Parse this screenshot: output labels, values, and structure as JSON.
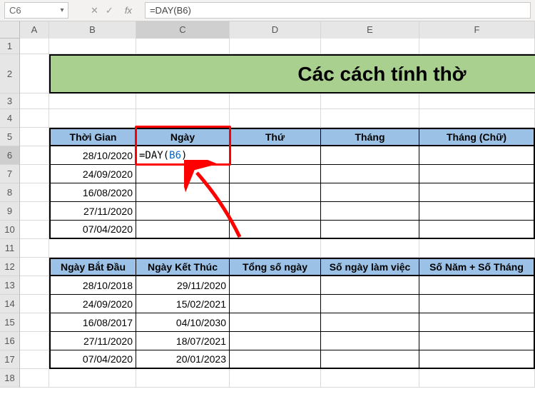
{
  "nameBox": "C6",
  "formulaBar": "=DAY(B6)",
  "title": "Các cách tính thờ",
  "columns": [
    "A",
    "B",
    "C",
    "D",
    "E",
    "F"
  ],
  "rows": [
    "1",
    "2",
    "3",
    "4",
    "5",
    "6",
    "7",
    "8",
    "9",
    "10",
    "11",
    "12",
    "13",
    "14",
    "15",
    "16",
    "17",
    "18"
  ],
  "activeCol": "C",
  "activeRow": "6",
  "table1": {
    "headers": [
      "Thời Gian",
      "Ngày",
      "Thứ",
      "Tháng",
      "Tháng (Chữ)"
    ],
    "rows": [
      {
        "date": "28/10/2020",
        "formula": "=DAY(",
        "ref": "B6",
        "close": ")"
      },
      {
        "date": "24/09/2020"
      },
      {
        "date": "16/08/2020"
      },
      {
        "date": "27/11/2020"
      },
      {
        "date": "07/04/2020"
      }
    ]
  },
  "table2": {
    "headers": [
      "Ngày Bắt Đầu",
      "Ngày Kết Thúc",
      "Tổng số ngày",
      "Số ngày làm việc",
      "Số Năm + Số Tháng"
    ],
    "rows": [
      {
        "start": "28/10/2018",
        "end": "29/11/2020"
      },
      {
        "start": "24/09/2020",
        "end": "15/02/2021"
      },
      {
        "start": "16/08/2017",
        "end": "04/10/2030"
      },
      {
        "start": "27/11/2020",
        "end": "18/07/2021"
      },
      {
        "start": "07/04/2020",
        "end": "20/01/2023"
      }
    ]
  },
  "chart_data": null
}
